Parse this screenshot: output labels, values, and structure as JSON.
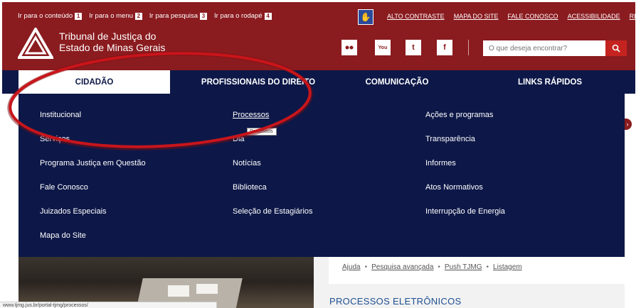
{
  "skip_links": [
    {
      "label": "Ir para o conteúdo",
      "key": "1"
    },
    {
      "label": "Ir para o menu",
      "key": "2"
    },
    {
      "label": "Ir para pesquisa",
      "key": "3"
    },
    {
      "label": "Ir para o rodapé",
      "key": "4"
    }
  ],
  "top_links": [
    "ALTO CONTRASTE",
    "MAPA DO SITE",
    "FALE CONOSCO",
    "ACESSIBILIDADE",
    "REDE TJMG"
  ],
  "logo": {
    "line1": "Tribunal de Justiça do",
    "line2": "Estado de Minas Gerais"
  },
  "social": [
    {
      "name": "flickr-icon",
      "glyph": "••"
    },
    {
      "name": "youtube-icon",
      "glyph": "You"
    },
    {
      "name": "twitter-icon",
      "glyph": "t"
    },
    {
      "name": "facebook-icon",
      "glyph": "f"
    }
  ],
  "search": {
    "placeholder": "O que deseja encontrar?"
  },
  "nav_tabs": [
    "CIDADÃO",
    "PROFISSIONAIS DO DIREITO",
    "COMUNICAÇÃO",
    "LINKS RÁPIDOS"
  ],
  "dropdown": {
    "col1": [
      "Institucional",
      "Serviços",
      "Programa Justiça em Questão",
      "Fale Conosco",
      "Juizados Especiais",
      "Mapa do Site"
    ],
    "col2": [
      "Processos",
      "Diá",
      "Notícias",
      "Biblioteca",
      "Seleção de Estagiários"
    ],
    "col3": [
      "Ações e programas",
      "Transparência",
      "Informes",
      "Atos Normativos",
      "Interrupção de Energia"
    ],
    "tooltip": "Processos"
  },
  "sub_links": [
    "Ajuda",
    "Pesquisa avançada",
    "Push TJMG",
    "Listagem"
  ],
  "section_title": "PROCESSOS ELETRÔNICOS",
  "status_url": "www.tjmg.jus.br/portal-tjmg/processos/",
  "colors": {
    "header_red": "#8a1b1f",
    "nav_navy": "#0d1848",
    "search_red": "#c5231f",
    "annotation_red": "#c8151b"
  }
}
